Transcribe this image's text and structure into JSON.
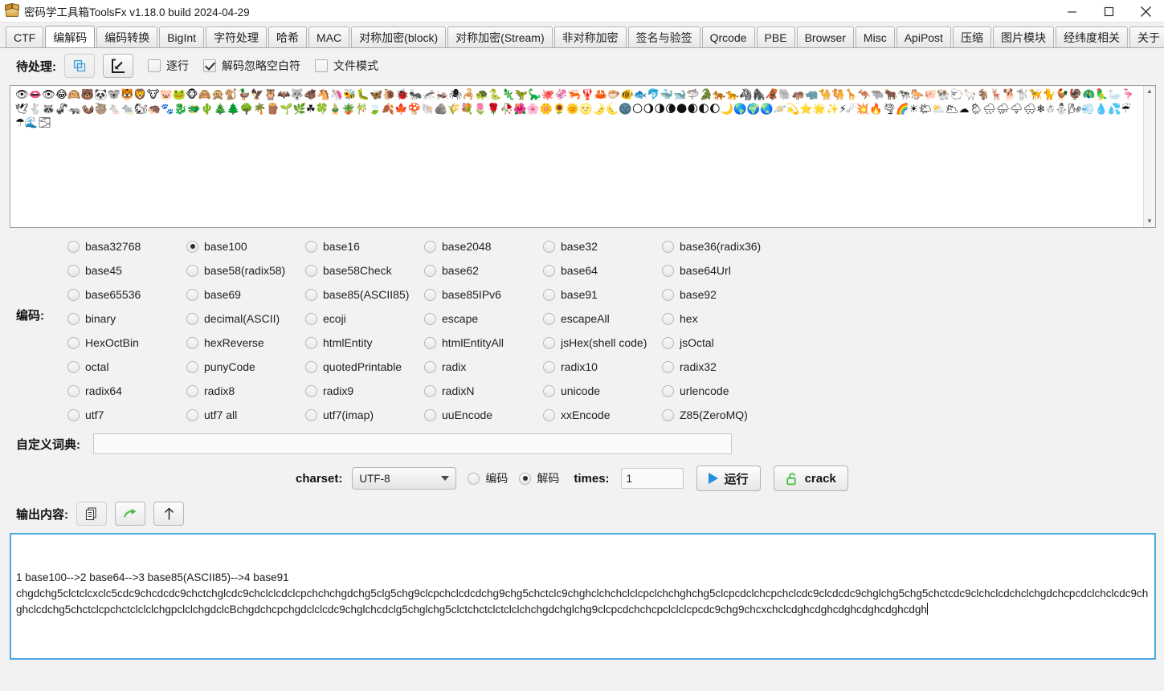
{
  "window": {
    "title": "密码学工具箱ToolsFx v1.18.0 build 2024-04-29",
    "app_icon": "toolbox-icon",
    "minimize": "minimize-icon",
    "maximize": "maximize-icon",
    "close": "close-icon"
  },
  "tabs": [
    {
      "label": "CTF",
      "active": false
    },
    {
      "label": "编解码",
      "active": true
    },
    {
      "label": "编码转换",
      "active": false
    },
    {
      "label": "BigInt",
      "active": false
    },
    {
      "label": "字符处理",
      "active": false
    },
    {
      "label": "哈希",
      "active": false
    },
    {
      "label": "MAC",
      "active": false
    },
    {
      "label": "对称加密(block)",
      "active": false
    },
    {
      "label": "对称加密(Stream)",
      "active": false
    },
    {
      "label": "非对称加密",
      "active": false
    },
    {
      "label": "签名与验签",
      "active": false
    },
    {
      "label": "Qrcode",
      "active": false
    },
    {
      "label": "PBE",
      "active": false
    },
    {
      "label": "Browser",
      "active": false
    },
    {
      "label": "Misc",
      "active": false
    },
    {
      "label": "ApiPost",
      "active": false
    },
    {
      "label": "压缩",
      "active": false
    },
    {
      "label": "图片模块",
      "active": false
    },
    {
      "label": "经纬度相关",
      "active": false
    },
    {
      "label": "关于",
      "active": false
    }
  ],
  "pending": {
    "label": "待处理:",
    "copy_button": "copy-layers-icon",
    "import_button": "import-arrow-icon",
    "checkboxes": [
      {
        "label": "逐行",
        "checked": false
      },
      {
        "label": "解码忽略空白符",
        "checked": true
      },
      {
        "label": "文件模式",
        "checked": false
      }
    ],
    "input_text": "👁👄👁😂🙉🐻🐼🐨🐯🦁🐮🐷🐸🐵🙈🙊🐒🦆🦅🦉🦇🐺🐗🐴🦄🐝🐛🦋🐌🐞🐜🦟🦗🕷🦂🐢🐍🦎🦖🦕🐙🦑🦐🦞🦀🐡🐠🐟🐬🐳🐋🦈🐊🐅🐆🦓🦍🦧🐘🦛🦏🐪🐫🦒🦘🐃🐂🐄🐎🐖🐏🐑🦙🐐🦌🐕🐩🦮🐈🐓🦃🦚🦜🦢🦩🕊🐇🦝🦨🦡🦦🦥🐁🐀🐿🦔🐾🐉🐲🌵🎄🌲🌳🌴🪵🌱🌿☘🍀🎍🪴🎋🍃🍂🍁🍄🐚🪨🌾💐🌷🌹🥀🌺🌸🌼🌻🌞🌝🌛🌜🌚🌕🌖🌗🌘🌑🌒🌓🌔🌙🌎🌍🌏🪐💫⭐🌟✨⚡☄💥🔥🌪🌈☀🌤⛅🌥☁🌦🌧⛈🌩🌨❄☃⛄🌬💨💧💦☔☂🌊🌫"
  },
  "codec": {
    "label": "编码:",
    "selected": "base100",
    "options": [
      "basa32768",
      "base100",
      "base16",
      "base2048",
      "base32",
      "base36(radix36)",
      "base45",
      "base58(radix58)",
      "base58Check",
      "base62",
      "base64",
      "base64Url",
      "base65536",
      "base69",
      "base85(ASCII85)",
      "base85IPv6",
      "base91",
      "base92",
      "binary",
      "decimal(ASCII)",
      "ecoji",
      "escape",
      "escapeAll",
      "hex",
      "HexOctBin",
      "hexReverse",
      "htmlEntity",
      "htmlEntityAll",
      "jsHex(shell code)",
      "jsOctal",
      "octal",
      "punyCode",
      "quotedPrintable",
      "radix",
      "radix10",
      "radix32",
      "radix64",
      "radix8",
      "radix9",
      "radixN",
      "unicode",
      "urlencode",
      "utf7",
      "utf7 all",
      "utf7(imap)",
      "uuEncode",
      "xxEncode",
      "Z85(ZeroMQ)"
    ]
  },
  "dictionary": {
    "label": "自定义词典:",
    "value": "",
    "placeholder": ""
  },
  "controls": {
    "charset_label": "charset:",
    "charset_value": "UTF-8",
    "mode_encode": "编码",
    "mode_decode": "解码",
    "mode_selected": "解码",
    "times_label": "times:",
    "times_value": "1",
    "run_button": "运行",
    "run_icon": "play-icon",
    "crack_button": "crack",
    "crack_icon": "unlock-icon"
  },
  "output": {
    "label": "输出内容:",
    "buttons": [
      {
        "name": "copy-icon"
      },
      {
        "name": "forward-arrow-icon"
      },
      {
        "name": "up-arrow-icon"
      }
    ],
    "line1": "1 base100-->2 base64-->3 base85(ASCII85)-->4 base91",
    "line2": "chgdchg5clctclcxclc5cdc9chcdcdc9chctchglcdc9chclclcdclcpchchchgdchg5clg5chg9clcpchclcdcdchg9chg5chctclc9chghclchchclclcpclchchghchg5clcpcdclchcpchclcdc9clcdcdc9chglchg5chg5chctcdc",
    "line3": "9clchclcdchclchgdchcpcdclchclcdc9chghclcdchg5chctclcpchctclclclchgpclclchgdclcBchgdchcpchgdclclcdc9chglchcdclg5chglchg5clctchctclctclclchchgdchglchg9clcpcdchchcpclclclcpcdc9chg9chcxchclcd",
    "line4": "ghcdghcdghcdghcdghcdgh"
  }
}
